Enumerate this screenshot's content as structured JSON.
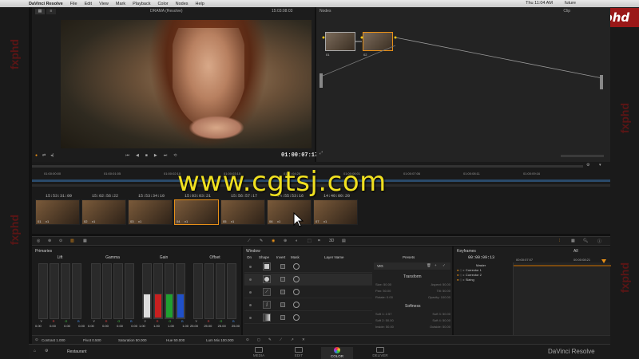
{
  "menubar": {
    "app": "DaVinci Resolve",
    "items": [
      "File",
      "Edit",
      "View",
      "Mark",
      "Playback",
      "Color",
      "Nodes",
      "Help"
    ],
    "clock": "Thu 11:04 AM",
    "user": "future"
  },
  "brand_watermark": "fxphd",
  "watermark_url": "www.cgtsj.com",
  "viewer": {
    "clip_name": "DRAMA (Resolve)",
    "timecode_top": "15:03:08:03",
    "timecode": "01:00:07:17"
  },
  "nodes": {
    "title": "Nodes",
    "clip_label": "Clip",
    "node1_id": "01",
    "node2_id": "02"
  },
  "timeline": {
    "ruler": [
      "01:00:00:00",
      "01:00:01:05",
      "01:00:02:10",
      "01:00:03:15",
      "01:00:04:20",
      "01:00:06:01",
      "01:00:07:06",
      "01:00:08:11",
      "01:00:09:16"
    ],
    "clips": [
      {
        "tc": "15:53:31:09",
        "id": "01",
        "track": "v1"
      },
      {
        "tc": "15:02:56:22",
        "id": "02",
        "track": "v1"
      },
      {
        "tc": "15:53:34:10",
        "id": "03",
        "track": "v1"
      },
      {
        "tc": "15:03:03:21",
        "id": "04",
        "track": "v1"
      },
      {
        "tc": "15:56:57:17",
        "id": "05",
        "track": "v1"
      },
      {
        "tc": "14:55:53:16",
        "id": "06",
        "track": "v1"
      },
      {
        "tc": "14:40:00:20",
        "id": "07",
        "track": "v1"
      }
    ]
  },
  "primaries": {
    "title": "Primaries",
    "wheels": [
      {
        "name": "Lift",
        "values": [
          "0.00",
          "0.00",
          "0.00",
          "0.00"
        ]
      },
      {
        "name": "Gamma",
        "values": [
          "0.00",
          "0.00",
          "0.00",
          "0.00"
        ]
      },
      {
        "name": "Gain",
        "values": [
          "1.00",
          "1.00",
          "1.00",
          "1.00"
        ]
      },
      {
        "name": "Offset",
        "values": [
          "25.00",
          "25.00",
          "25.00",
          "25.00"
        ]
      }
    ],
    "channels": [
      "Y",
      "R",
      "G",
      "B"
    ],
    "footer": {
      "contrast": "Contrast 1.000",
      "pivot": "Pivot 0.500",
      "saturation": "Saturation 50.000",
      "hue": "Hue 50.000",
      "lum_mix": "Lum Mix 100.000"
    }
  },
  "window": {
    "title": "Window",
    "columns": [
      "On",
      "Shape",
      "Invert",
      "Mask",
      "Layer Name",
      "Presets"
    ],
    "preset": "VIG"
  },
  "transform": {
    "title": "Transform",
    "rows": [
      [
        "Size: 50.00",
        "Aspect: 50.00"
      ],
      [
        "Pan: 50.00",
        "Tilt: 50.00"
      ],
      [
        "Rotate: 0.00",
        "Opacity: 100.00"
      ]
    ]
  },
  "softness": {
    "title": "Softness",
    "rows": [
      [
        "Soft 1: 2.57",
        "Soft 3: 50.00"
      ],
      [
        "Soft 2: 50.00",
        "Soft 4: 50.00"
      ],
      [
        "Inside: 50.00",
        "Outside: 50.00"
      ]
    ]
  },
  "keyframes": {
    "title": "Keyframes",
    "filter": "All",
    "tc_current": "00:00:09:13",
    "tc_left": "00:00:07:07",
    "tc_right": "00:00:08:21",
    "tracks": [
      "Master",
      "Corrector 1",
      "Corrector 2",
      "Sizing"
    ]
  },
  "footer_nav": {
    "project": "Restaurant",
    "items": [
      "MEDIA",
      "EDIT",
      "COLOR",
      "DELIVER"
    ],
    "brand": "DaVinci Resolve"
  },
  "colors": {
    "accent": "#e89018",
    "watermark": "#f0e020"
  }
}
